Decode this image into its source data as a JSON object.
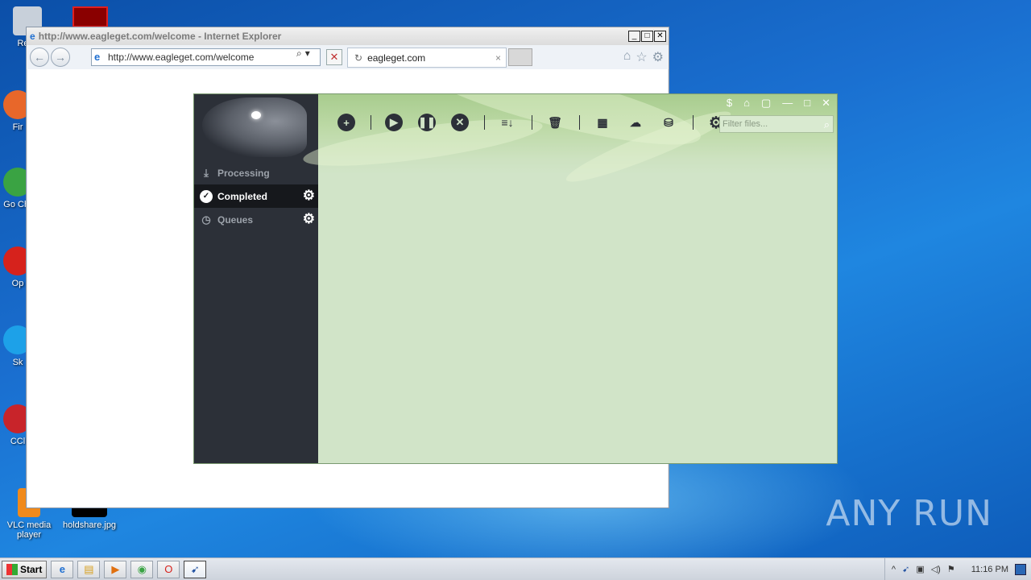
{
  "desktop": {
    "icons": [
      {
        "label": "Recy",
        "color": "#c8d0da"
      },
      {
        "label": "Fir",
        "color": "#e8672a"
      },
      {
        "label": "Go Chr",
        "color": "#3aa343"
      },
      {
        "label": "Op",
        "color": "#d6221c"
      },
      {
        "label": "Sk",
        "color": "#1da1e8"
      },
      {
        "label": "CCl",
        "color": "#c8242a"
      },
      {
        "label": "VLC media player",
        "color": "#f08a1c"
      },
      {
        "label": "holdshare.jpg",
        "color": "#000000"
      }
    ],
    "watermark": "ANY RUN"
  },
  "ie": {
    "title": "http://www.eagleget.com/welcome - Internet Explorer",
    "address": "http://www.eagleget.com/welcome",
    "tab_label": "eagleget.com",
    "ctrl_min": "_",
    "ctrl_max": "□",
    "ctrl_close": "✕",
    "back": "←",
    "forward": "→",
    "tab_close": "×",
    "stop": "✕"
  },
  "eagleget": {
    "nav": [
      {
        "label": "Processing"
      },
      {
        "label": "Completed"
      },
      {
        "label": "Queues"
      }
    ],
    "filter_placeholder": "Filter files...",
    "top_controls": [
      "$",
      "⌂",
      "▢",
      "—",
      "□",
      "✕"
    ],
    "accent": "#2c3038",
    "bg": "#d1e4c8"
  },
  "taskbar": {
    "start_label": "Start",
    "time": "11:16 PM",
    "tray_arrow": "^"
  }
}
